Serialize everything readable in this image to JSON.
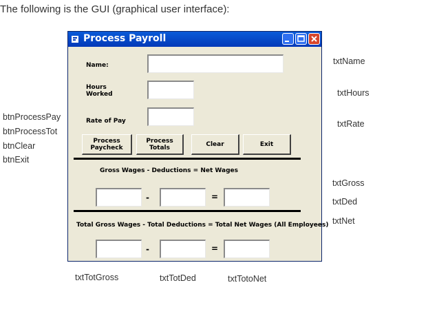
{
  "heading": "The following is the GUI (graphical user interface):",
  "window": {
    "title": "Process Payroll",
    "labels": {
      "name": "Name:",
      "hours": "Hours\nWorked",
      "rate": "Rate of Pay",
      "gross_formula": "Gross Wages - Deductions = Net Wages",
      "total_formula": "Total Gross Wages - Total Deductions = Total Net Wages (All Employees)"
    },
    "buttons": {
      "process_paycheck": "Process\nPaycheck",
      "process_totals": "Process\nTotals",
      "clear": "Clear",
      "exit": "Exit"
    },
    "operators": {
      "minus": "-",
      "equals": "="
    }
  },
  "annotations": {
    "left": [
      "btnProcessPay",
      "btnProcessTot",
      "btnClear",
      "btnExit"
    ],
    "right": [
      "txtName",
      "txtHours",
      "txtRate",
      "txtGross",
      "txtDed",
      "txtNet"
    ],
    "bottom": [
      "txtTotGross",
      "txtTotDed",
      "txtTotoNet"
    ]
  }
}
